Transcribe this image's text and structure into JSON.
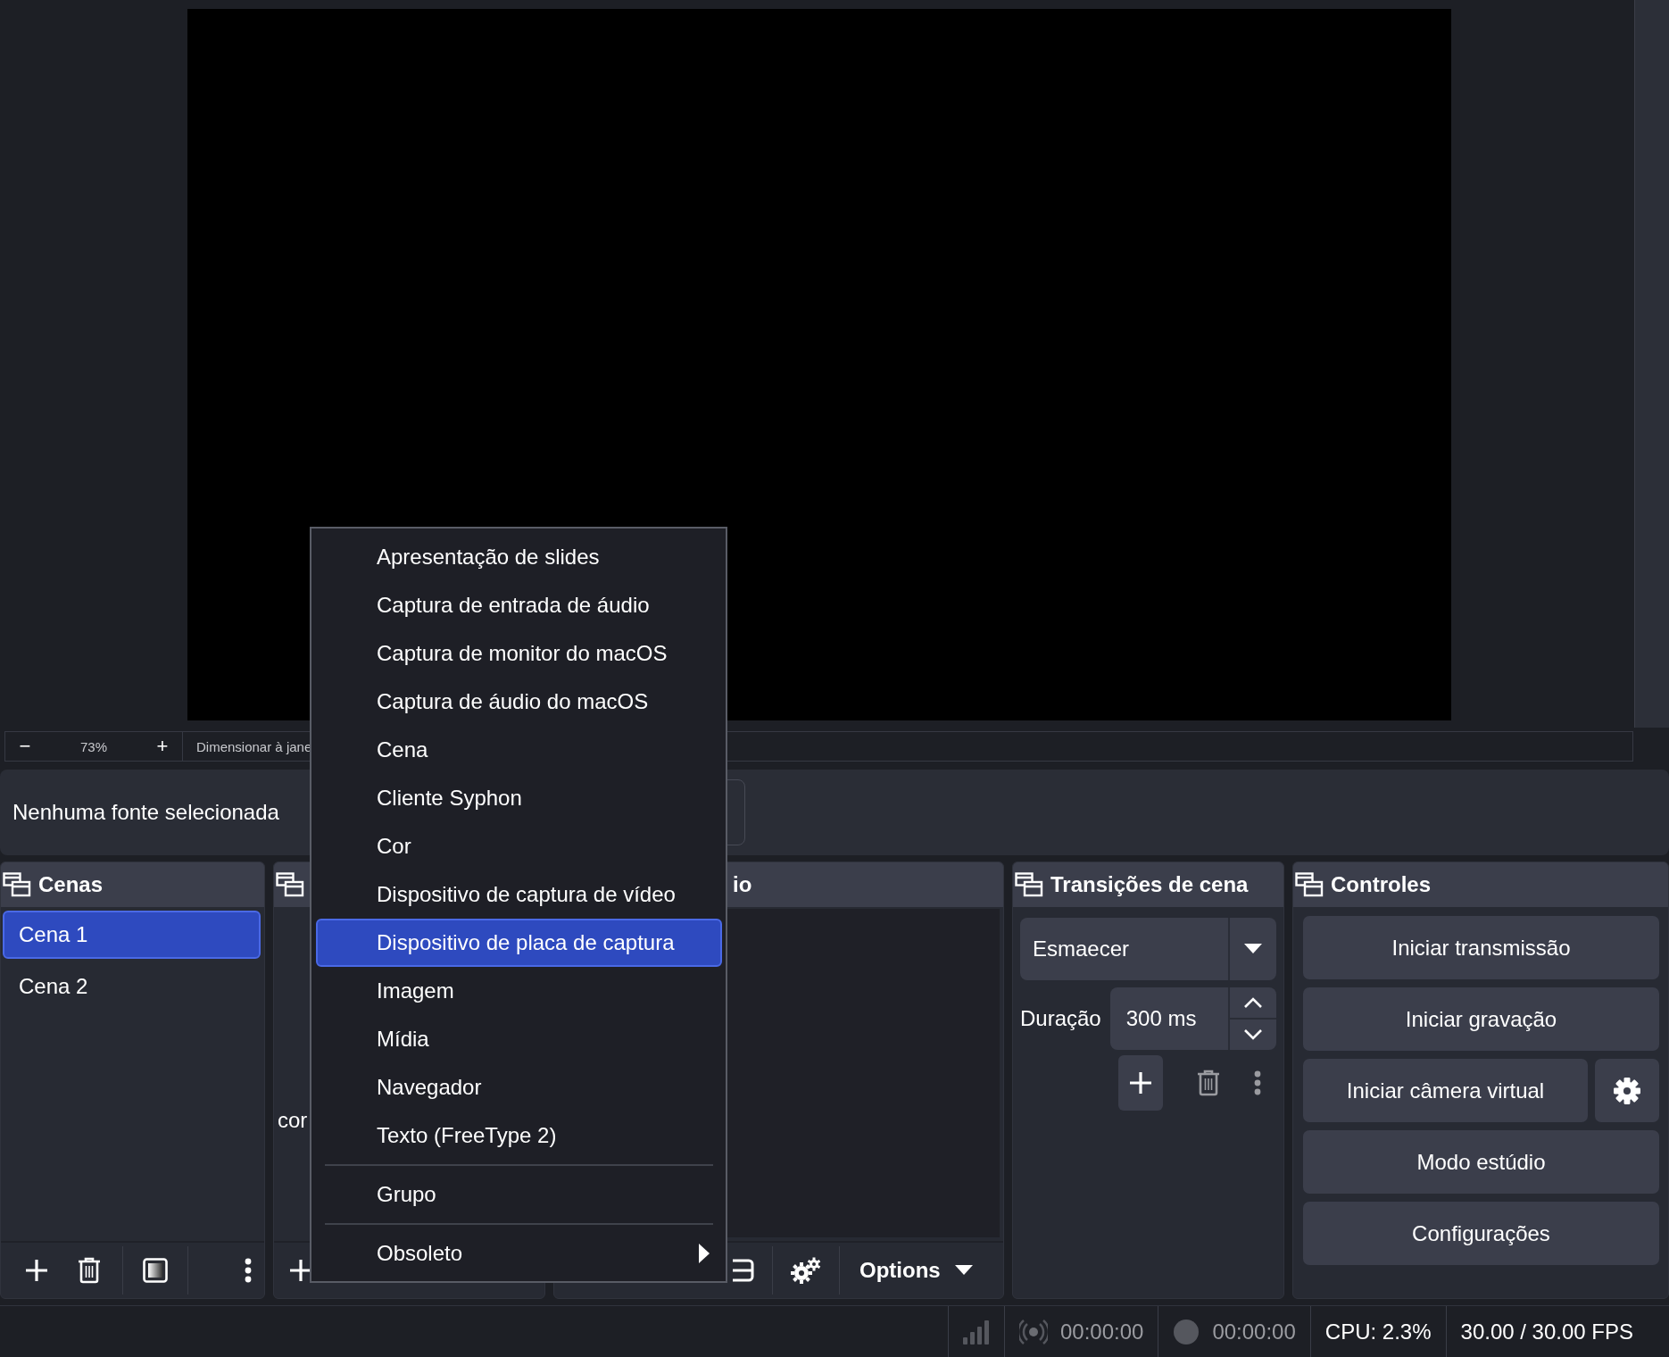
{
  "preview": {
    "zoom_out": "−",
    "zoom": "73%",
    "zoom_in": "+",
    "fit": "Dimensionar à jane"
  },
  "context_bar": {
    "label": "Nenhuma fonte selecionada"
  },
  "scenes": {
    "title": "Cenas",
    "items": [
      {
        "label": "Cena 1",
        "selected": true
      },
      {
        "label": "Cena 2",
        "selected": false
      }
    ]
  },
  "sources": {
    "hint": "cor"
  },
  "mixer": {
    "title": "io",
    "options": "Options"
  },
  "transitions": {
    "title": "Transições de cena",
    "transition": "Esmaecer",
    "duration_label": "Duração",
    "duration": "300 ms"
  },
  "controls": {
    "title": "Controles",
    "buttons": [
      {
        "label": "Iniciar transmissão",
        "kind": "plain"
      },
      {
        "label": "Iniciar gravação",
        "kind": "plain"
      },
      {
        "label": "Iniciar câmera virtual",
        "kind": "with_settings"
      },
      {
        "label": "Modo estúdio",
        "kind": "plain"
      },
      {
        "label": "Configurações",
        "kind": "plain"
      }
    ]
  },
  "status_bar": {
    "stream_time": "00:00:00",
    "record_time": "00:00:00",
    "cpu": "CPU: 2.3%",
    "fps": "30.00 / 30.00 FPS"
  },
  "context_menu": {
    "items": [
      {
        "kind": "item",
        "label": "Apresentação de slides",
        "selected": false
      },
      {
        "kind": "item",
        "label": "Captura de entrada de áudio",
        "selected": false
      },
      {
        "kind": "item",
        "label": "Captura de monitor do macOS",
        "selected": false
      },
      {
        "kind": "item",
        "label": "Captura de áudio do macOS",
        "selected": false
      },
      {
        "kind": "item",
        "label": "Cena",
        "selected": false
      },
      {
        "kind": "item",
        "label": "Cliente Syphon",
        "selected": false
      },
      {
        "kind": "item",
        "label": "Cor",
        "selected": false
      },
      {
        "kind": "item",
        "label": "Dispositivo de captura de vídeo",
        "selected": false
      },
      {
        "kind": "item",
        "label": "Dispositivo de placa de captura",
        "selected": true
      },
      {
        "kind": "item",
        "label": "Imagem",
        "selected": false
      },
      {
        "kind": "item",
        "label": "Mídia",
        "selected": false
      },
      {
        "kind": "item",
        "label": "Navegador",
        "selected": false
      },
      {
        "kind": "item",
        "label": "Texto (FreeType 2)",
        "selected": false
      },
      {
        "kind": "separator"
      },
      {
        "kind": "item",
        "label": "Grupo",
        "selected": false
      },
      {
        "kind": "separator"
      },
      {
        "kind": "submenu",
        "label": "Obsoleto",
        "selected": false
      }
    ]
  }
}
